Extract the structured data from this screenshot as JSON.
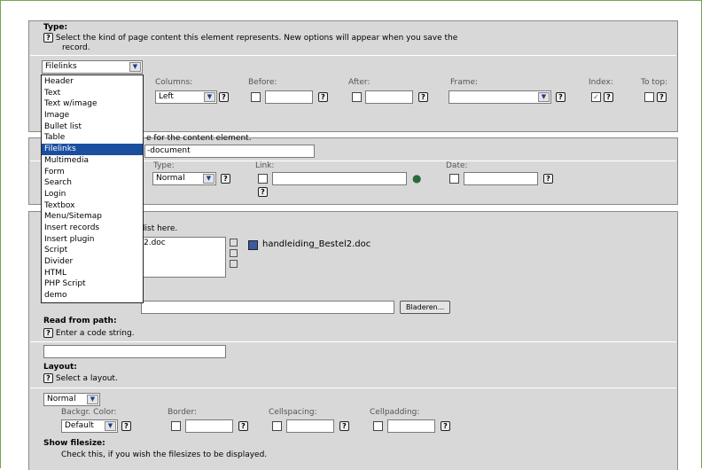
{
  "type_section": {
    "title": "Type:",
    "desc": "Select the kind of page content this element represents. New options will appear when you save the",
    "desc2": "record.",
    "type_value": "Filelinks",
    "columns_label": "Columns:",
    "columns_value": "Left",
    "before_label": "Before:",
    "after_label": "After:",
    "frame_label": "Frame:",
    "index_label": "Index:",
    "totop_label": "To top:"
  },
  "type_dropdown": {
    "options": [
      "Header",
      "Text",
      "Text w/image",
      "Image",
      "Bullet list",
      "Table",
      "Filelinks",
      "Multimedia",
      "Form",
      "Search",
      "Login",
      "Textbox",
      "Menu/Sitemap",
      "Insert records",
      "Insert plugin",
      "Script",
      "Divider",
      "HTML",
      "PHP Script",
      "demo"
    ],
    "selected": "Filelinks"
  },
  "header_section": {
    "desc_tail": "e for the content element.",
    "header_value_tail": "-document",
    "type_label": "Type:",
    "type_value": "Normal",
    "link_label": "Link:",
    "date_label": "Date:"
  },
  "files_section": {
    "list_tail": "list here.",
    "file_item_tail": "2.doc",
    "file_name": "handleiding_Bestel2.doc",
    "browse_label": "Bladeren...",
    "read_from_path_title": "Read from path:",
    "read_from_path_desc": "Enter a code string.",
    "layout_title": "Layout:",
    "layout_desc": "Select a layout.",
    "layout_value": "Normal",
    "bgcolor_label": "Backgr. Color:",
    "bgcolor_value": "Default",
    "border_label": "Border:",
    "cellspacing_label": "Cellspacing:",
    "cellpadding_label": "Cellpadding:",
    "show_filesize_title": "Show filesize:",
    "show_filesize_desc": "Check this, if you wish the filesizes to be displayed."
  },
  "help_glyph": "?",
  "arrow_glyph": "▼",
  "check_glyph": "✓"
}
